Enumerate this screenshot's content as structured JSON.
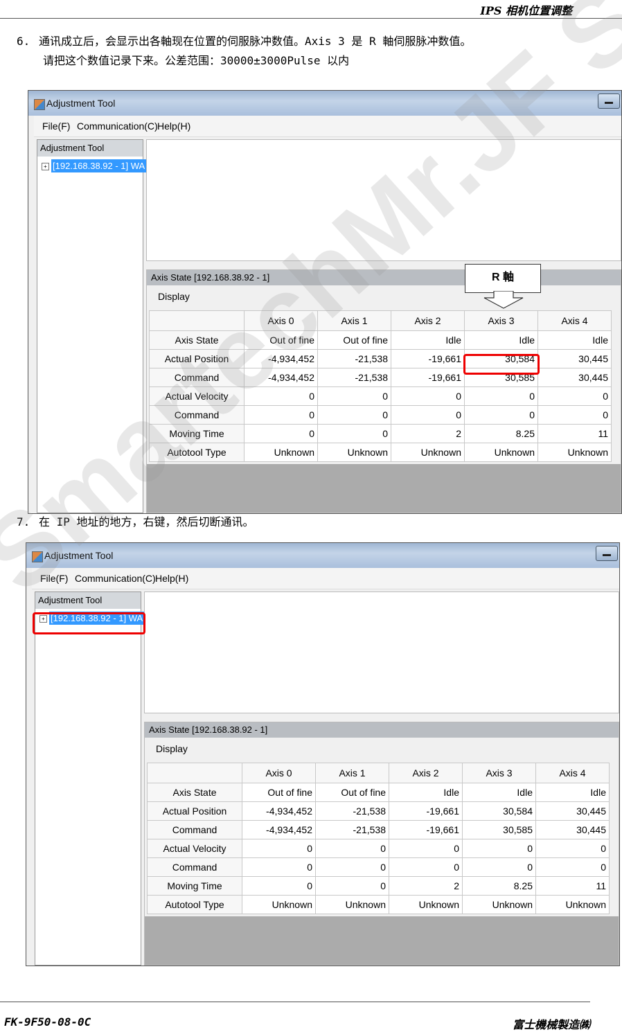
{
  "header": {
    "title": "IPS 相机位置调整"
  },
  "steps": [
    {
      "num": "6.",
      "line1": "通讯成立后，会显示出各軸现在位置的伺服脉冲数值。Axis  3 是 R 軸伺服脉冲数值。",
      "line2": "请把这个数值记录下来。公差范围：30000±3000Pulse 以内"
    },
    {
      "num": "7.",
      "line1": "在 IP 地址的地方，右键，然后切断通讯。"
    }
  ],
  "window": {
    "title": "Adjustment Tool",
    "menu": [
      "File(F)",
      "Communication(C)",
      "Help(H)"
    ],
    "tree_header": "Adjustment Tool",
    "tree_node": "[192.168.38.92 - 1] WA",
    "axis_panel_title": "Axis State [192.168.38.92 - 1]",
    "display_label": "Display",
    "columns": [
      "Axis 0",
      "Axis 1",
      "Axis 2",
      "Axis 3",
      "Axis 4"
    ],
    "rows": [
      {
        "label": "Axis State",
        "values": [
          "Out of fine",
          "Out of fine",
          "Idle",
          "Idle",
          "Idle"
        ]
      },
      {
        "label": "Actual Position",
        "values": [
          "-4,934,452",
          "-21,538",
          "-19,661",
          "30,584",
          "30,445"
        ]
      },
      {
        "label": "Command",
        "values": [
          "-4,934,452",
          "-21,538",
          "-19,661",
          "30,585",
          "30,445"
        ]
      },
      {
        "label": "Actual Velocity",
        "values": [
          "0",
          "0",
          "0",
          "0",
          "0"
        ]
      },
      {
        "label": "Command",
        "values": [
          "0",
          "0",
          "0",
          "0",
          "0"
        ]
      },
      {
        "label": "Moving Time",
        "values": [
          "0",
          "0",
          "2",
          "8.25",
          "11"
        ]
      },
      {
        "label": "Autotool Type",
        "values": [
          "Unknown",
          "Unknown",
          "Unknown",
          "Unknown",
          "Unknown"
        ]
      }
    ]
  },
  "callout": "R 軸",
  "watermark": "SmartechMr.JF Sun",
  "footer": {
    "left": "FK-9F50-08-0C",
    "right": "富士機械製造㈱"
  }
}
